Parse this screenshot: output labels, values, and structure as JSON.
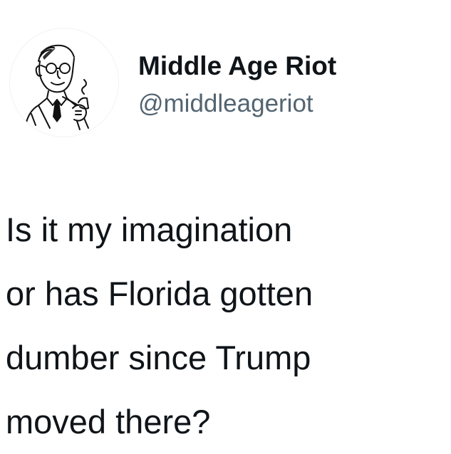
{
  "tweet": {
    "author": {
      "display_name": "Middle Age Riot",
      "handle": "@middleageriot",
      "avatar_icon": "pipe-smoking-man-avatar"
    },
    "text_lines": [
      "Is it my imagination",
      "or has Florida gotten",
      "dumber since Trump",
      "moved there?"
    ]
  },
  "colors": {
    "background": "#ffffff",
    "text": "#0f1419",
    "handle": "#536471"
  }
}
